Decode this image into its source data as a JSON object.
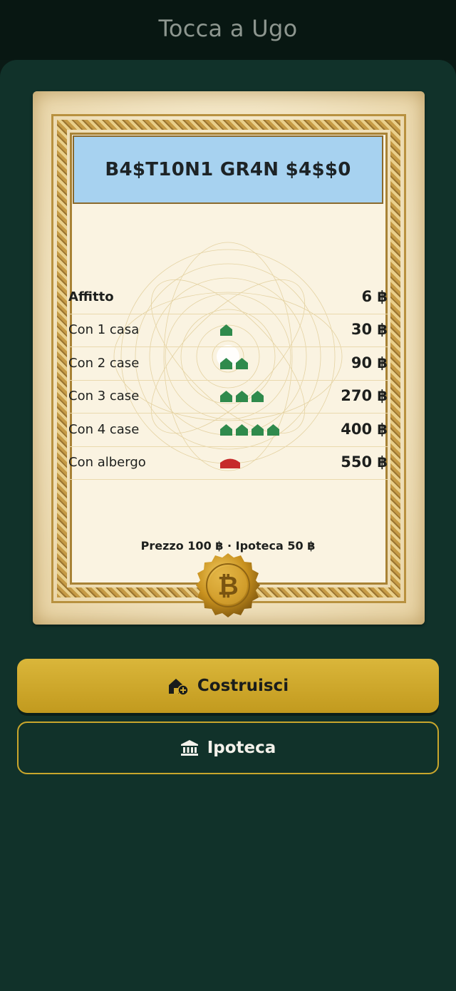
{
  "header": {
    "title": "Tocca a Ugo"
  },
  "card": {
    "name": "B4$T10N1 GR4N $4$$0",
    "header_color": "#a7d2f0",
    "rent_rows": [
      {
        "label": "Affitto",
        "value": "6 ฿",
        "houses": 0,
        "hotel": false
      },
      {
        "label": "Con 1 casa",
        "value": "30 ฿",
        "houses": 1,
        "hotel": false
      },
      {
        "label": "Con 2 case",
        "value": "90 ฿",
        "houses": 2,
        "hotel": false
      },
      {
        "label": "Con 3 case",
        "value": "270 ฿",
        "houses": 3,
        "hotel": false
      },
      {
        "label": "Con 4 case",
        "value": "400 ฿",
        "houses": 4,
        "hotel": false
      },
      {
        "label": "Con albergo",
        "value": "550 ฿",
        "houses": 0,
        "hotel": true
      }
    ],
    "footer": "Prezzo 100 ฿ · Ipoteca 50 ฿",
    "seal_icon": "bitcoin-seal-icon",
    "house_color": "#2f8a4c",
    "hotel_color": "#c62a2a"
  },
  "actions": {
    "build": {
      "label": "Costruisci",
      "icon": "house-plus-icon"
    },
    "mortgage": {
      "label": "Ipoteca",
      "icon": "bank-icon"
    }
  }
}
